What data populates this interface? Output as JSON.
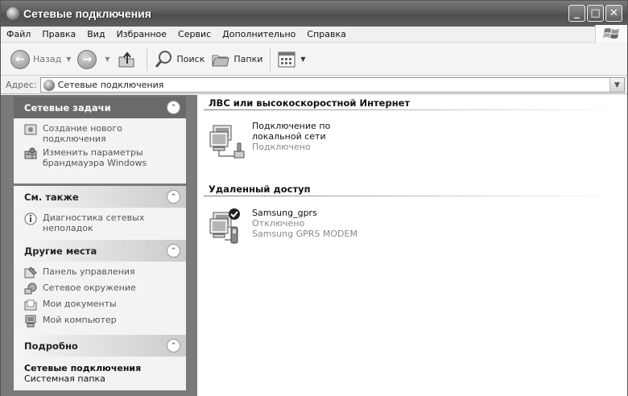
{
  "window": {
    "title": "Сетевые подключения",
    "min": "_",
    "max": "□",
    "close": "✕"
  },
  "menu": [
    "Файл",
    "Правка",
    "Вид",
    "Избранное",
    "Сервис",
    "Дополнительно",
    "Справка"
  ],
  "toolbar": {
    "back": "Назад",
    "search": "Поиск",
    "folders": "Папки"
  },
  "address": {
    "label": "Адрес:",
    "value": "Сетевые подключения"
  },
  "left": {
    "network_tasks": {
      "title": "Сетевые задачи",
      "items": [
        "Создание нового подключения",
        "Изменить параметры брандмауэра Windows"
      ]
    },
    "see_also": {
      "title": "См. также",
      "items": [
        "Диагностика сетевых неполадок"
      ]
    },
    "other_places": {
      "title": "Другие места",
      "items": [
        "Панель управления",
        "Сетевое окружение",
        "Мои документы",
        "Мой компьютер"
      ]
    },
    "details": {
      "title": "Подробно",
      "name": "Сетевые подключения",
      "type": "Системная папка"
    }
  },
  "right": {
    "lan_group": "ЛВС или высокоскоростной Интернет",
    "lan_conn": {
      "name": "Подключение по локальной сети",
      "status": "Подключено"
    },
    "dialup_group": "Удаленный доступ",
    "dialup_conn": {
      "name": "Samsung_gprs",
      "status": "Отключено",
      "device": "Samsung GPRS MODEM"
    }
  }
}
